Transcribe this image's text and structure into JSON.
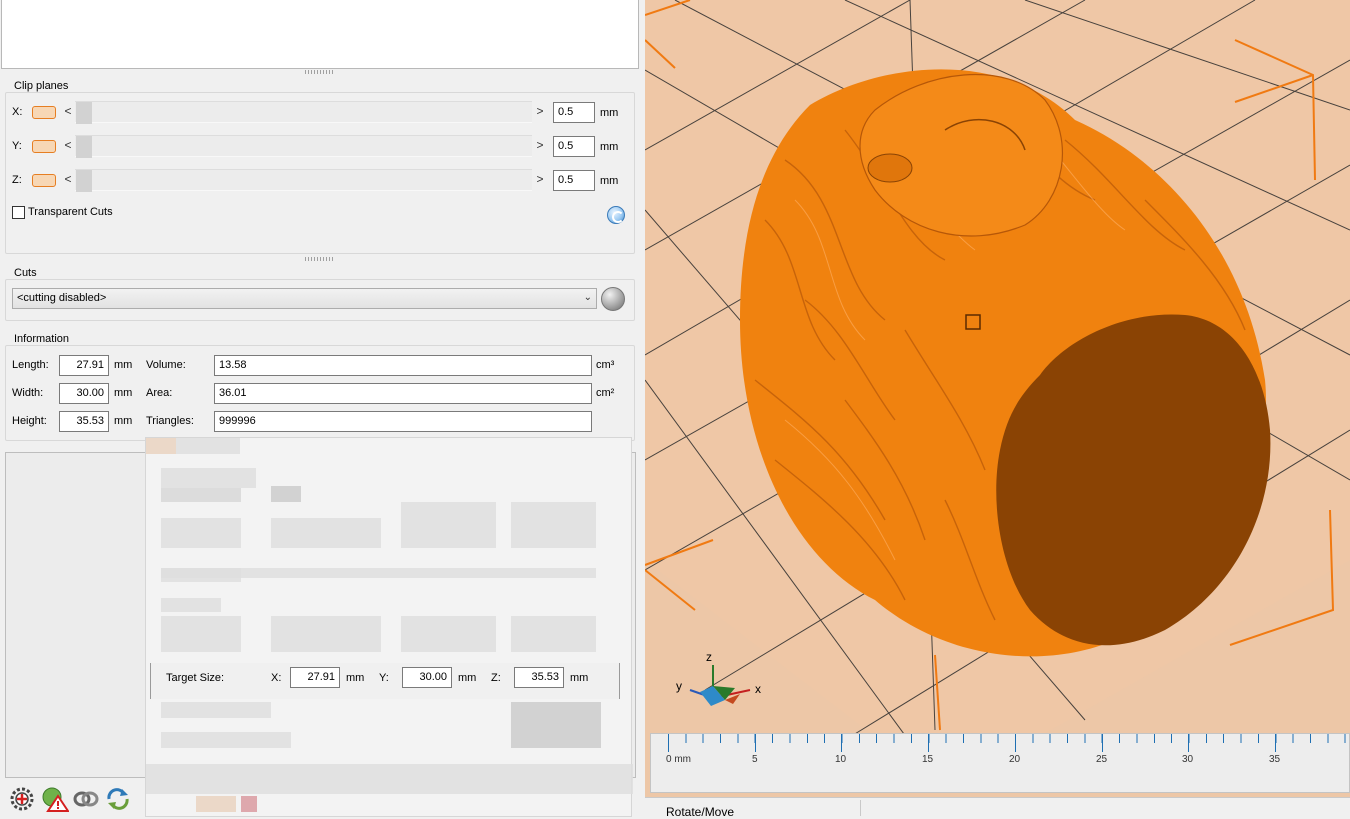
{
  "clip_planes": {
    "title": "Clip planes",
    "unit": "mm",
    "rows": [
      {
        "axis": "X:",
        "value": "0.5"
      },
      {
        "axis": "Y:",
        "value": "0.5"
      },
      {
        "axis": "Z:",
        "value": "0.5"
      }
    ],
    "left_arrow": "<",
    "right_arrow": ">",
    "transparent_cuts_label": "Transparent Cuts"
  },
  "cuts": {
    "title": "Cuts",
    "selected": "<cutting disabled>"
  },
  "information": {
    "title": "Information",
    "length_label": "Length:",
    "length_value": "27.91",
    "width_label": "Width:",
    "width_value": "30.00",
    "height_label": "Height:",
    "height_value": "35.53",
    "unit_mm": "mm",
    "volume_label": "Volume:",
    "volume_value": "13.58",
    "area_label": "Area:",
    "area_value": "36.01",
    "triangles_label": "Triangles:",
    "triangles_value": "999996",
    "unit_cm3": "cm³",
    "unit_cm2": "cm²"
  },
  "target_size": {
    "label": "Target Size:",
    "x_label": "X:",
    "x_value": "27.91",
    "y_label": "Y:",
    "y_value": "30.00",
    "z_label": "Z:",
    "z_value": "35.53",
    "unit": "mm"
  },
  "viewport": {
    "axis_labels": {
      "x": "x",
      "y": "y",
      "z": "z"
    },
    "ruler_labels": [
      "0 mm",
      "5",
      "10",
      "15",
      "20",
      "25",
      "30",
      "35"
    ],
    "model_color": "#f0820f",
    "cut_face_color": "#8a4304",
    "background_color": "#edc7a7"
  },
  "status_bar": {
    "mode": "Rotate/Move"
  },
  "icons": [
    "gear-icon",
    "warning-icon",
    "link-icon",
    "sync-icon",
    "refresh-icon",
    "globe-icon"
  ]
}
